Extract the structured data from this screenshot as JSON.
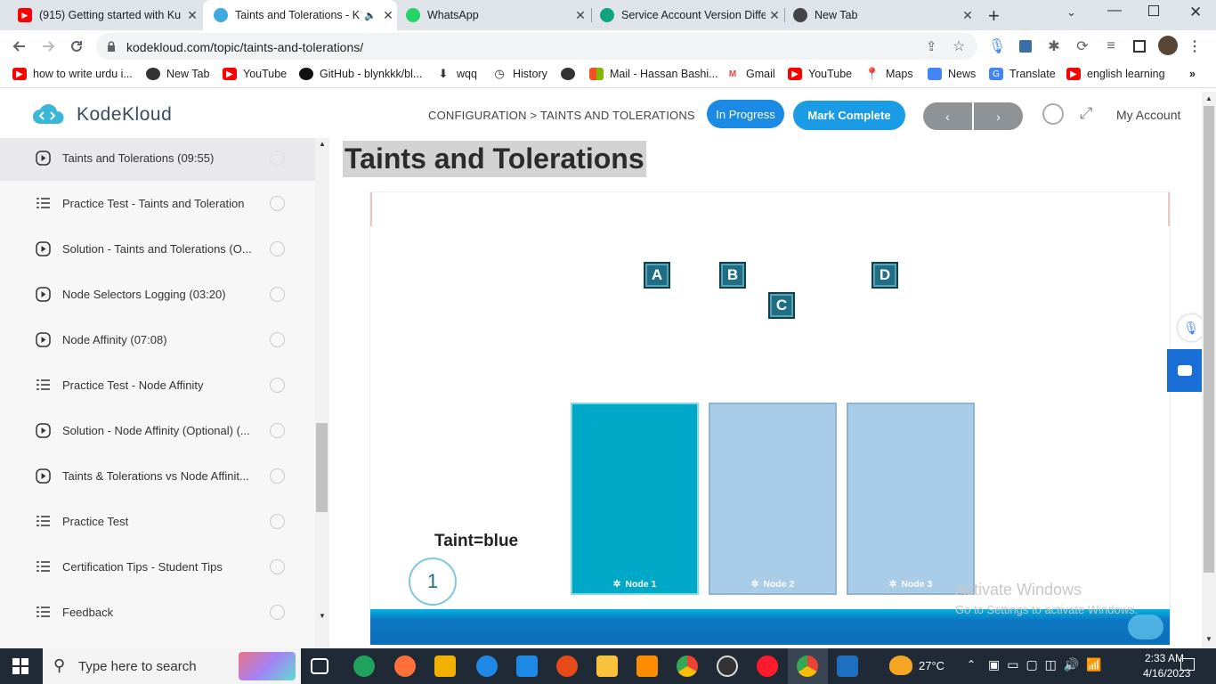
{
  "browser": {
    "tabs": [
      {
        "title": "(915) Getting started with Ku",
        "favicon_color": "#ff0000"
      },
      {
        "title": "Taints and Tolerations - K",
        "favicon_color": "#3fa9e0"
      },
      {
        "title": "WhatsApp",
        "favicon_color": "#25d366"
      },
      {
        "title": "Service Account Version Diffe",
        "favicon_color": "#10a37f"
      },
      {
        "title": "New Tab",
        "favicon_color": "#444444"
      }
    ],
    "url": "kodekloud.com/topic/taints-and-tolerations/",
    "bookmarks": [
      {
        "label": "how to write urdu i...",
        "icon_color": "#ff0000"
      },
      {
        "label": "New Tab",
        "icon_color": "#333333"
      },
      {
        "label": "YouTube",
        "icon_color": "#ff0000"
      },
      {
        "label": "GitHub - blynkkk/bl...",
        "icon_color": "#111111"
      },
      {
        "label": "wqq",
        "icon_color": "#333333"
      },
      {
        "label": "History",
        "icon_color": "#333333"
      },
      {
        "label": "",
        "icon_color": "#333333"
      },
      {
        "label": "Mail - Hassan Bashi...",
        "icon_color": "#f25022"
      },
      {
        "label": "Gmail",
        "icon_color": "#ea4335"
      },
      {
        "label": "YouTube",
        "icon_color": "#ff0000"
      },
      {
        "label": "Maps",
        "icon_color": "#34a853"
      },
      {
        "label": "News",
        "icon_color": "#4285f4"
      },
      {
        "label": "Translate",
        "icon_color": "#4285f4"
      },
      {
        "label": "english learning",
        "icon_color": "#ff0000"
      }
    ]
  },
  "header": {
    "logo": "KodeKloud",
    "breadcrumb": "CONFIGURATION > TAINTS AND TOLERATIONS",
    "status": "In Progress",
    "mark_complete": "Mark Complete",
    "prev": "‹",
    "next": "›",
    "account": "My Account"
  },
  "sidebar": {
    "items": [
      {
        "label": "Taints and Tolerations (09:55)",
        "type": "video",
        "active": true
      },
      {
        "label": "Practice Test - Taints and Toleration",
        "type": "lab"
      },
      {
        "label": "Solution - Taints and Tolerations (O...",
        "type": "video"
      },
      {
        "label": "Node Selectors Logging (03:20)",
        "type": "video"
      },
      {
        "label": "Node Affinity (07:08)",
        "type": "video"
      },
      {
        "label": "Practice Test - Node Affinity",
        "type": "lab"
      },
      {
        "label": "Solution - Node Affinity (Optional) (...",
        "type": "video"
      },
      {
        "label": "Taints & Tolerations vs Node Affinit...",
        "type": "video"
      },
      {
        "label": "Practice Test",
        "type": "lab"
      },
      {
        "label": "Certification Tips - Student Tips",
        "type": "lab"
      },
      {
        "label": "Feedback",
        "type": "lab"
      }
    ]
  },
  "main": {
    "title": "Taints and Tolerations",
    "video": {
      "pods": [
        "A",
        "B",
        "C",
        "D"
      ],
      "nodes": [
        {
          "label": "Node 1",
          "color": "#00a8c8"
        },
        {
          "label": "Node 2",
          "color": "#a9cce8"
        },
        {
          "label": "Node 3",
          "color": "#a9cce8"
        }
      ],
      "taint_label": "Taint=blue",
      "step": "1"
    },
    "watermark_title": "Activate Windows",
    "watermark_sub": "Go to Settings to activate Windows."
  },
  "taskbar": {
    "search_placeholder": "Type here to search",
    "weather": "27°C",
    "time": "2:33 AM",
    "date": "4/16/2023"
  }
}
